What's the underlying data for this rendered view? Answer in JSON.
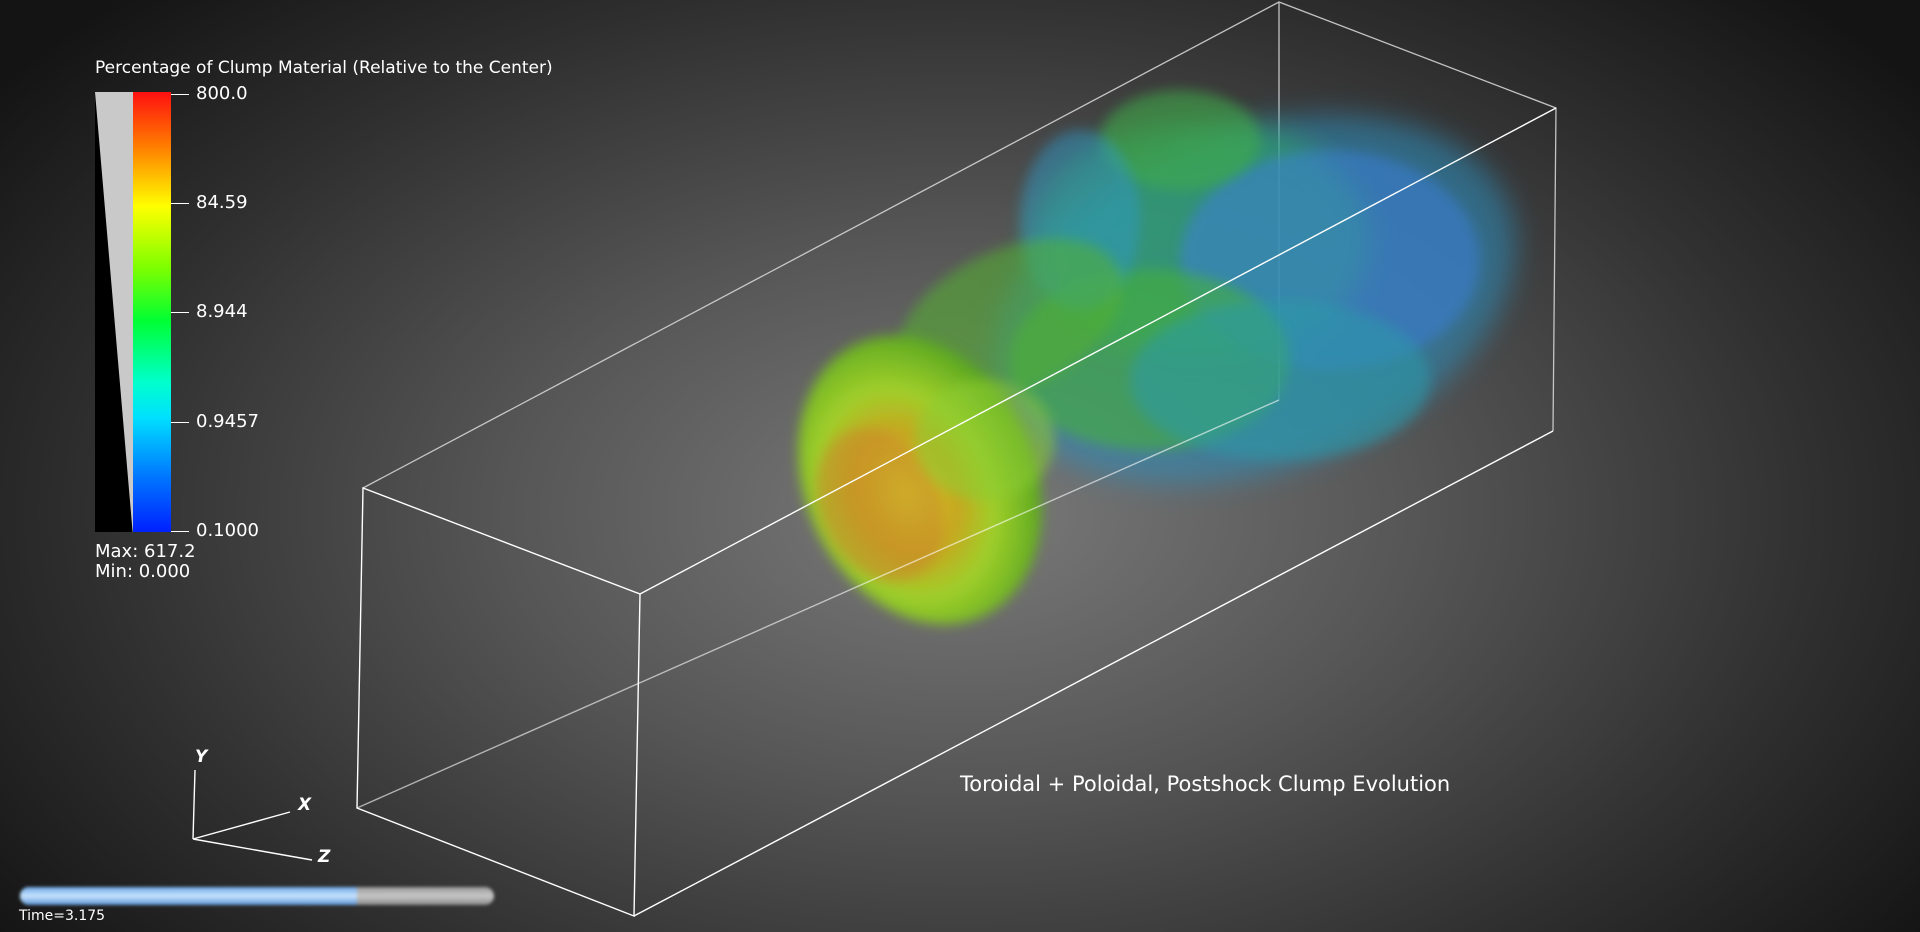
{
  "legend": {
    "title": "Percentage of Clump Material (Relative to the Center)",
    "ticks": [
      "800.0",
      "84.59",
      "8.944",
      "0.9457",
      "0.1000"
    ],
    "max_text": "Max:  617.2",
    "min_text": "Min:  0.000",
    "colormap": [
      "#ff1010",
      "#ff7a00",
      "#ffff00",
      "#7dff00",
      "#00ff33",
      "#00ffcc",
      "#00e0ff",
      "#007aff",
      "#0020ff"
    ]
  },
  "caption": "Toroidal + Poloidal, Postshock Clump Evolution",
  "axes": {
    "y": "Y",
    "x": "X",
    "z": "Z"
  },
  "timeline": {
    "label": "Time=3.175",
    "progress": 0.71
  }
}
